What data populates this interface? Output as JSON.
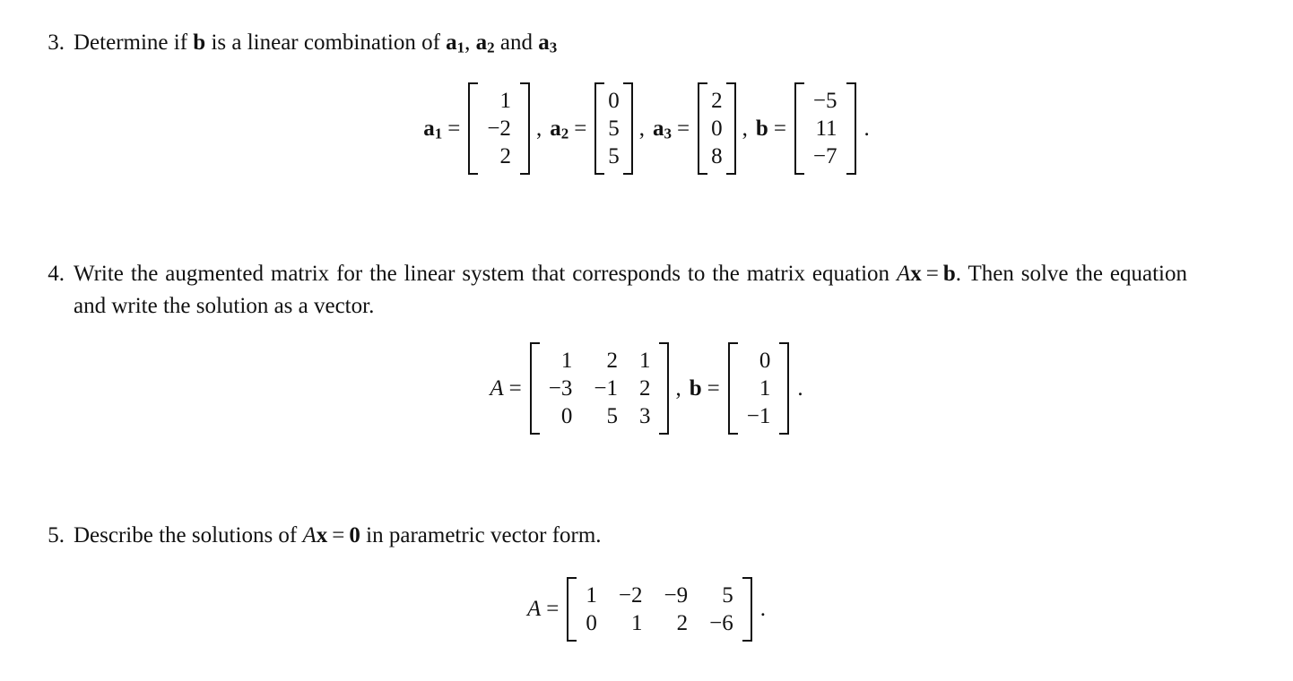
{
  "document": {
    "type": "math-worksheet",
    "background": "#ffffff",
    "text_color": "#111111"
  },
  "problems": [
    {
      "number": "3.",
      "text_before_b": "Determine if ",
      "b_symbol": "b",
      "text_middle": " is a linear combination of ",
      "a1_symbol": "a",
      "a1_sub": "1",
      "sep1": ", ",
      "a2_symbol": "a",
      "a2_sub": "2",
      "sep2": " and ",
      "a3_symbol": "a",
      "a3_sub": "3"
    },
    {
      "number": "4.",
      "line1_part1": "Write the augmented matrix for the linear system that corresponds to the matrix equation ",
      "line1_A": "A",
      "line1_x": "x",
      "line1_eq": "=",
      "line1_b": "b",
      "line1_end": ".",
      "line2": "Then solve the equation and write the solution as a vector."
    },
    {
      "number": "5.",
      "part1": "Describe the solutions of ",
      "A": "A",
      "x": "x",
      "eq": "=",
      "zero": "0",
      "part2": " in parametric vector form."
    }
  ],
  "display3": {
    "items": [
      {
        "label": "a",
        "sub": "1",
        "eq": "=",
        "rows": [
          [
            "1"
          ],
          [
            "−2"
          ],
          [
            "2"
          ]
        ],
        "trailer": ","
      },
      {
        "label": "a",
        "sub": "2",
        "eq": "=",
        "rows": [
          [
            "0"
          ],
          [
            "5"
          ],
          [
            "5"
          ]
        ],
        "trailer": ","
      },
      {
        "label": "a",
        "sub": "3",
        "eq": "=",
        "rows": [
          [
            "2"
          ],
          [
            "0"
          ],
          [
            "8"
          ]
        ],
        "trailer": ","
      },
      {
        "label": "b",
        "sub": "",
        "eq": "=",
        "rows": [
          [
            "−5"
          ],
          [
            "11"
          ],
          [
            "−7"
          ]
        ],
        "trailer": "."
      }
    ]
  },
  "display4": {
    "A_label": "A",
    "A_eq": "=",
    "A_rows": [
      [
        "1",
        "2",
        "1"
      ],
      [
        "−3",
        "−1",
        "2"
      ],
      [
        "0",
        "5",
        "3"
      ]
    ],
    "comma": ",",
    "b_label": "b",
    "b_eq": "=",
    "b_rows": [
      [
        "0"
      ],
      [
        "1"
      ],
      [
        "−1"
      ]
    ],
    "period": "."
  },
  "display5": {
    "A_label": "A",
    "A_eq": "=",
    "rows": [
      [
        "1",
        "−2",
        "−9",
        "5"
      ],
      [
        "0",
        "1",
        "2",
        "−6"
      ]
    ],
    "period": "."
  },
  "chart_data": {
    "type": "table",
    "title": "Linear algebra worksheet vectors and matrices",
    "entries": [
      {
        "name": "a1",
        "problem": 3,
        "shape": [
          3,
          1
        ],
        "values": [
          [
            1
          ],
          [
            -2
          ],
          [
            2
          ]
        ]
      },
      {
        "name": "a2",
        "problem": 3,
        "shape": [
          3,
          1
        ],
        "values": [
          [
            0
          ],
          [
            5
          ],
          [
            5
          ]
        ]
      },
      {
        "name": "a3",
        "problem": 3,
        "shape": [
          3,
          1
        ],
        "values": [
          [
            2
          ],
          [
            0
          ],
          [
            8
          ]
        ]
      },
      {
        "name": "b",
        "problem": 3,
        "shape": [
          3,
          1
        ],
        "values": [
          [
            -5
          ],
          [
            11
          ],
          [
            -7
          ]
        ]
      },
      {
        "name": "A",
        "problem": 4,
        "shape": [
          3,
          3
        ],
        "values": [
          [
            1,
            2,
            1
          ],
          [
            -3,
            -1,
            2
          ],
          [
            0,
            5,
            3
          ]
        ]
      },
      {
        "name": "b",
        "problem": 4,
        "shape": [
          3,
          1
        ],
        "values": [
          [
            0
          ],
          [
            1
          ],
          [
            -1
          ]
        ]
      },
      {
        "name": "A",
        "problem": 5,
        "shape": [
          2,
          4
        ],
        "values": [
          [
            1,
            -2,
            -9,
            5
          ],
          [
            0,
            1,
            2,
            -6
          ]
        ]
      }
    ]
  }
}
